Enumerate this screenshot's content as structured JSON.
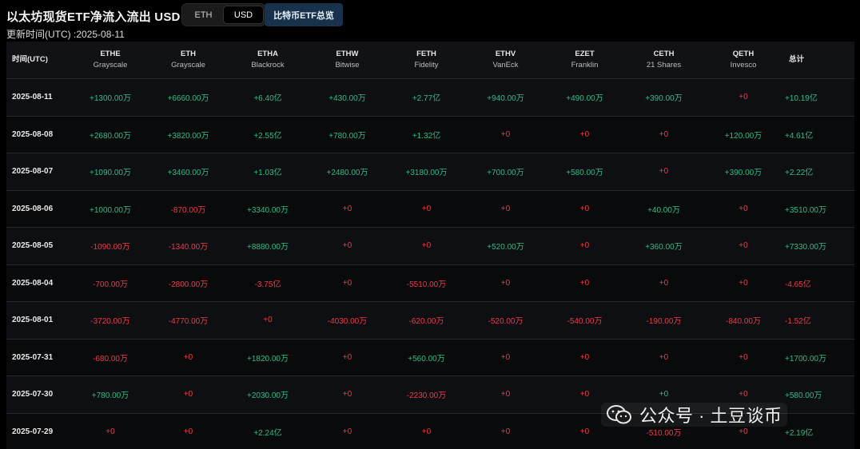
{
  "header": {
    "title": "以太坊现货ETF净流入流出 USD",
    "updated": "更新时间(UTC) :2025-08-11",
    "toggle": [
      "ETH",
      "USD"
    ],
    "active_toggle": "USD",
    "summary_button": "比特币ETF总览"
  },
  "columns": [
    {
      "code": "时间(UTC)",
      "sub": ""
    },
    {
      "code": "ETHE",
      "sub": "Grayscale"
    },
    {
      "code": "ETH",
      "sub": "Grayscale"
    },
    {
      "code": "ETHA",
      "sub": "Blackrock"
    },
    {
      "code": "ETHW",
      "sub": "Bitwise"
    },
    {
      "code": "FETH",
      "sub": "Fidelity"
    },
    {
      "code": "ETHV",
      "sub": "VanEck"
    },
    {
      "code": "EZET",
      "sub": "Franklin"
    },
    {
      "code": "CETH",
      "sub": "21 Shares"
    },
    {
      "code": "QETH",
      "sub": "Invesco"
    },
    {
      "code": "总计",
      "sub": ""
    }
  ],
  "rows": [
    {
      "date": "2025-08-11",
      "values": [
        "+1300.00万",
        "+6660.00万",
        "+6.40亿",
        "+430.00万",
        "+2.77亿",
        "+940.00万",
        "+490.00万",
        "+390.00万",
        "+0",
        "+10.19亿"
      ]
    },
    {
      "date": "2025-08-08",
      "values": [
        "+2680.00万",
        "+3820.00万",
        "+2.55亿",
        "+780.00万",
        "+1.32亿",
        "+0",
        "+0",
        "+0",
        "+120.00万",
        "+4.61亿"
      ]
    },
    {
      "date": "2025-08-07",
      "values": [
        "+1090.00万",
        "+3460.00万",
        "+1.03亿",
        "+2480.00万",
        "+3180.00万",
        "+700.00万",
        "+580.00万",
        "+0",
        "+390.00万",
        "+2.22亿"
      ]
    },
    {
      "date": "2025-08-06",
      "values": [
        "+1000.00万",
        "-870.00万",
        "+3340.00万",
        "+0",
        "+0",
        "+0",
        "+0",
        "+40.00万",
        "+0",
        "+3510.00万"
      ]
    },
    {
      "date": "2025-08-05",
      "values": [
        "-1090.00万",
        "-1340.00万",
        "+8880.00万",
        "+0",
        "+0",
        "+520.00万",
        "+0",
        "+360.00万",
        "+0",
        "+7330.00万"
      ]
    },
    {
      "date": "2025-08-04",
      "values": [
        "-700.00万",
        "-2800.00万",
        "-3.75亿",
        "+0",
        "-5510.00万",
        "+0",
        "+0",
        "+0",
        "+0",
        "-4.65亿"
      ]
    },
    {
      "date": "2025-08-01",
      "values": [
        "-3720.00万",
        "-4770.00万",
        "+0",
        "-4030.00万",
        "-620.00万",
        "-520.00万",
        "-540.00万",
        "-190.00万",
        "-840.00万",
        "-1.52亿"
      ]
    },
    {
      "date": "2025-07-31",
      "values": [
        "-680.00万",
        "+0",
        "+1820.00万",
        "+0",
        "+560.00万",
        "+0",
        "+0",
        "+0",
        "+0",
        "+1700.00万"
      ]
    },
    {
      "date": "2025-07-30",
      "values": [
        "+780.00万",
        "+0",
        "+2030.00万",
        "+0",
        "-2230.00万",
        "+0",
        "+0",
        "+0",
        "+0",
        "+580.00万"
      ]
    },
    {
      "date": "2025-07-29",
      "values": [
        "+0",
        "+0",
        "+2.24亿",
        "+0",
        "+0",
        "+0",
        "+0",
        "-510.00万",
        "+0",
        "+2.19亿"
      ]
    }
  ],
  "zero_colors": {
    "2025-08-11": [
      "",
      "",
      "",
      "",
      "",
      "",
      "",
      "",
      "neg",
      ""
    ],
    "2025-08-08": [
      "",
      "",
      "",
      "",
      "",
      "neg",
      "neg",
      "neg",
      "",
      ""
    ],
    "2025-08-07": [
      "",
      "",
      "",
      "",
      "",
      "",
      "",
      "neg",
      "",
      ""
    ],
    "2025-08-06": [
      "",
      "",
      "",
      "neg",
      "neg",
      "neg",
      "neg",
      "",
      "neg",
      ""
    ],
    "2025-08-05": [
      "",
      "",
      "",
      "neg",
      "neg",
      "",
      "neg",
      "",
      "neg",
      ""
    ],
    "2025-08-04": [
      "",
      "",
      "",
      "neg",
      "",
      "neg",
      "neg",
      "neg",
      "neg",
      ""
    ],
    "2025-08-01": [
      "",
      "",
      "neg",
      "",
      "",
      "",
      "",
      "",
      "",
      ""
    ],
    "2025-07-31": [
      "",
      "neg",
      "",
      "neg",
      "",
      "neg",
      "neg",
      "neg",
      "neg",
      ""
    ],
    "2025-07-30": [
      "",
      "neg",
      "",
      "neg",
      "",
      "neg",
      "neg",
      "",
      "neg",
      ""
    ],
    "2025-07-29": [
      "neg",
      "neg",
      "",
      "neg",
      "neg",
      "neg",
      "neg",
      "",
      "neg",
      ""
    ]
  },
  "colors": {
    "positive": "#2ebd85",
    "negative": "#f0384a",
    "background": "#000000"
  },
  "watermark": {
    "text": "公众号 · 土豆谈币",
    "icon": "wechat-icon"
  }
}
